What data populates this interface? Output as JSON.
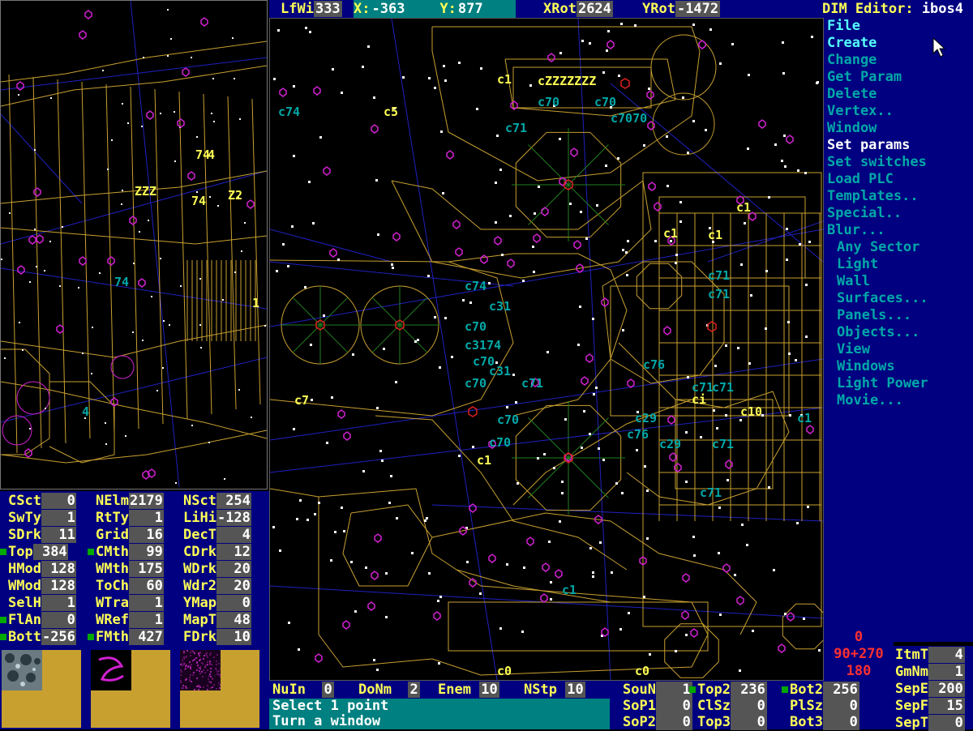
{
  "topbar": {
    "lfwi_label": "LfWi",
    "lfwi_value": "333",
    "x_label": "X:",
    "x_value": "-363",
    "y_label": "Y:",
    "y_value": "877",
    "xrot_label": "XRot",
    "xrot_value": "2624",
    "yrot_label": "YRot",
    "yrot_value": "-1472",
    "title_label": "DIM Editor:",
    "title_value": "ibos4"
  },
  "menu": {
    "items": [
      {
        "label": "File",
        "state": "highlight"
      },
      {
        "label": "Create",
        "state": "highlight"
      },
      {
        "label": "Change",
        "state": "normal"
      },
      {
        "label": "Get Param",
        "state": "normal"
      },
      {
        "label": "Delete",
        "state": "normal"
      },
      {
        "label": "Vertex..",
        "state": "normal"
      },
      {
        "label": "Window",
        "state": "normal"
      },
      {
        "label": "Set params",
        "state": "selected"
      },
      {
        "label": "Set switches",
        "state": "normal"
      },
      {
        "label": "Load PLC",
        "state": "normal"
      },
      {
        "label": "Templates..",
        "state": "normal"
      },
      {
        "label": "Special..",
        "state": "normal"
      },
      {
        "label": "Blur...",
        "state": "normal"
      }
    ],
    "subitems": [
      "Any Sector",
      "Light",
      "Wall",
      "Surfaces...",
      "Panels...",
      "Objects...",
      "View",
      "Windows",
      "Light Power",
      "Movie..."
    ]
  },
  "viewport_labels": [
    {
      "text": "1",
      "c": "y"
    },
    {
      "text": "ZZZZZZZ",
      "c": "y"
    },
    {
      "text": "70",
      "c": "c"
    },
    {
      "text": "70",
      "c": "c"
    },
    {
      "text": "7070",
      "c": "c"
    },
    {
      "text": "71",
      "c": "c"
    },
    {
      "text": "74",
      "c": "c"
    },
    {
      "text": "1",
      "c": "y"
    },
    {
      "text": "1",
      "c": "y"
    },
    {
      "text": "1",
      "c": "y"
    },
    {
      "text": "71",
      "c": "c"
    },
    {
      "text": "71",
      "c": "c"
    },
    {
      "text": "74",
      "c": "c"
    },
    {
      "text": "31",
      "c": "c"
    },
    {
      "text": "70",
      "c": "c"
    },
    {
      "text": "3174",
      "c": "c"
    },
    {
      "text": "70",
      "c": "c"
    },
    {
      "text": "31",
      "c": "c"
    },
    {
      "text": "70",
      "c": "c"
    },
    {
      "text": "71",
      "c": "c"
    },
    {
      "text": "76",
      "c": "c"
    },
    {
      "text": "71",
      "c": "c"
    },
    {
      "text": "71",
      "c": "c"
    },
    {
      "text": "7",
      "c": "y"
    },
    {
      "text": "70",
      "c": "c"
    },
    {
      "text": "70",
      "c": "c"
    },
    {
      "text": "29",
      "c": "c"
    },
    {
      "text": "76",
      "c": "c"
    },
    {
      "text": "29",
      "c": "c"
    },
    {
      "text": "71",
      "c": "c"
    },
    {
      "text": "i",
      "c": "y"
    },
    {
      "text": "10",
      "c": "y"
    },
    {
      "text": "1",
      "c": "c"
    },
    {
      "text": "1",
      "c": "y"
    },
    {
      "text": "71",
      "c": "c"
    },
    {
      "text": "0",
      "c": "y"
    },
    {
      "text": "0",
      "c": "y"
    },
    {
      "text": "5",
      "c": "y"
    },
    {
      "text": "1",
      "c": "c"
    }
  ],
  "preview_labels": [
    {
      "text": "74",
      "c": "y"
    },
    {
      "text": "4",
      "c": "y"
    },
    {
      "text": "ZZZ",
      "c": "y"
    },
    {
      "text": "74",
      "c": "y"
    },
    {
      "text": "Z2",
      "c": "y"
    },
    {
      "text": "74",
      "c": "c"
    },
    {
      "text": "1",
      "c": "y"
    },
    {
      "text": "4",
      "c": "c"
    }
  ],
  "stats": {
    "rows": [
      [
        {
          "k": "CSct",
          "v": "0"
        },
        {
          "k": "NElm",
          "v": "2179"
        },
        {
          "k": "NSct",
          "v": "254"
        }
      ],
      [
        {
          "k": "SwTy",
          "v": "1"
        },
        {
          "k": "RtTy",
          "v": "1"
        },
        {
          "k": "LiHi",
          "v": "-128"
        }
      ],
      [
        {
          "k": "SDrk",
          "v": "11"
        },
        {
          "k": "Grid",
          "v": "16"
        },
        {
          "k": "DecT",
          "v": "4"
        }
      ],
      [
        {
          "k": "Top",
          "v": "384",
          "dot": true
        },
        {
          "k": "CMth",
          "v": "99",
          "dot": true
        },
        {
          "k": "CDrk",
          "v": "12"
        }
      ],
      [
        {
          "k": "HMod",
          "v": "128"
        },
        {
          "k": "WMth",
          "v": "175"
        },
        {
          "k": "WDrk",
          "v": "20"
        }
      ],
      [
        {
          "k": "WMod",
          "v": "128"
        },
        {
          "k": "ToCh",
          "v": "60"
        },
        {
          "k": "Wdr2",
          "v": "20"
        }
      ],
      [
        {
          "k": "SelH",
          "v": "1"
        },
        {
          "k": "WTra",
          "v": "1"
        },
        {
          "k": "YMap",
          "v": "0"
        }
      ],
      [
        {
          "k": "FlAn",
          "v": "0",
          "dot": true
        },
        {
          "k": "WRef",
          "v": "1"
        },
        {
          "k": "MapT",
          "v": "48"
        }
      ],
      [
        {
          "k": "Bott",
          "v": "-256",
          "dot": true
        },
        {
          "k": "FMth",
          "v": "427",
          "dot": true
        },
        {
          "k": "FDrk",
          "v": "10"
        }
      ]
    ]
  },
  "status": {
    "nuin_label": "NuIn",
    "nuin_value": "0",
    "donm_label": "DoNm",
    "donm_value": "2",
    "enem_label": "Enem",
    "enem_value": "10",
    "nstp_label": "NStp",
    "nstp_value": "10",
    "message_line1": "Select 1 point",
    "message_line2": "Turn a window"
  },
  "rstats": {
    "cols": [
      [
        {
          "k": "SouN",
          "v": "1"
        },
        {
          "k": "SoP1",
          "v": "0"
        },
        {
          "k": "SoP2",
          "v": "0"
        }
      ],
      [
        {
          "k": "Top2",
          "v": "236",
          "dot": true
        },
        {
          "k": "ClSz",
          "v": "0"
        },
        {
          "k": "Top3",
          "v": "0"
        }
      ],
      [
        {
          "k": "Bot2",
          "v": "256",
          "dot": true
        },
        {
          "k": "PlSz",
          "v": "0"
        },
        {
          "k": "Bot3",
          "v": "0"
        }
      ]
    ]
  },
  "angles": {
    "a1": "0",
    "a2": "90+270",
    "a3": "180"
  },
  "far": [
    {
      "k": "ItmT",
      "v": "4"
    },
    {
      "k": "GmNm",
      "v": "1"
    },
    {
      "k": "SepE",
      "v": "200"
    },
    {
      "k": "SepF",
      "v": "15"
    },
    {
      "k": "SepT",
      "v": "0"
    }
  ],
  "colors": {
    "yellow": "#ffff55",
    "cyan": "#00a8a8",
    "panel": "#000080",
    "wire": "#c8a030",
    "blue_lines": "#2020c0"
  }
}
